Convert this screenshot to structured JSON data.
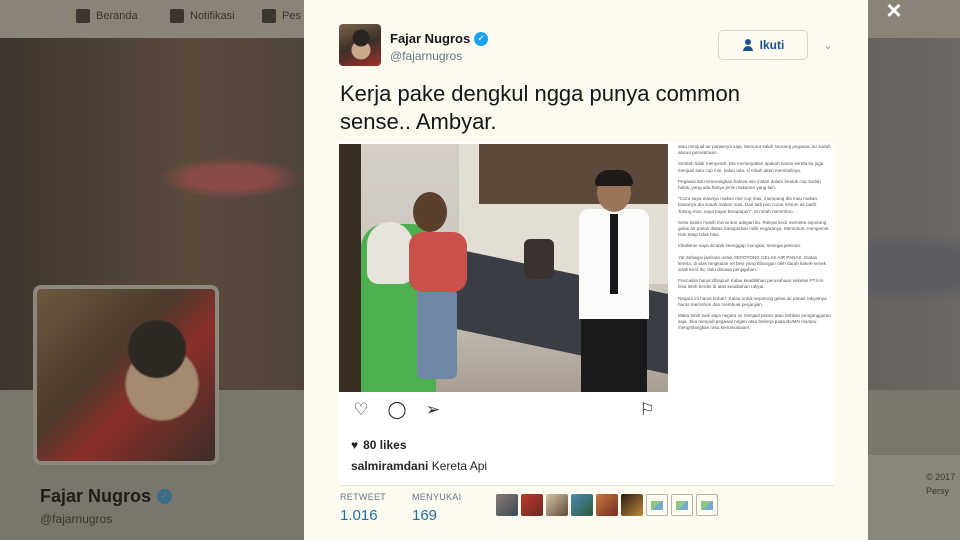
{
  "nav": {
    "home_label": "Beranda",
    "notifications_label": "Notifikasi",
    "messages_label": "Pes"
  },
  "profile": {
    "name": "Fajar Nugros",
    "handle": "@fajarnugros",
    "verified_mark": "✓"
  },
  "footer": {
    "copyright": "© 2017",
    "extra": "Persy"
  },
  "close_label": "×",
  "tweet": {
    "author_name": "Fajar Nugros",
    "author_handle": "@fajarnugros",
    "verified_mark": "✓",
    "follow_label": "Ikuti",
    "menu_caret": "⌄",
    "text": "Kerja pake dengkul ngga punya common sense.. Ambyar.",
    "media": {
      "likes_heart": "♥",
      "likes": "80 likes",
      "caption_user": "salmiramdani",
      "caption_text": "Kereta Api",
      "article_paragraphs": [
        "atau menjual air panasnya saja. Menurut salah seorang pegawai, itu sudah aturan perusahaan.",
        "Simbah tidak menyerah. Dia menanyakan apakah kantin kereta itu juga menjual satu cup mie, kalau ada, si mbah akan membelinya.",
        "Pegawai tsb menerangkan bahwa mie instan dalam bentuk cup sudah habis, yang ada hanya jenis makanan yang lain.",
        "\"Cucu saya maunya makan mie cup mas, mumpung dia mau makan, biasanya dia susah makan mas. Dari tadi pun cuma minum air putih. Tolong mas, saya bayar berapapun\". Si mbah memohon.",
        "Sesa kantin masih menonton adegan itu. Rakyat kecil meminta sepotong gelas air panas diatas transportasi milik negaranya. Memohon, mengemis. Dan tetap tidak bisa.",
        "Idealisme saya dicabik seenggap mungkin, sesegai jaminan.",
        "Ya! Sebagai jaminan untuk SEPOTONG GELAS AIR PANAS. Diatas kereta, di atas rangkaian rel besi yang dibangun oleh darah kakek-nenek anak kecil itu, dulu dimasa penjajahan.",
        "Pancasila harus dihapus! Kalau keadilahan perusahaan sekelas PT.KAI bisa lebih berdiri di atas keadilahan rakyat.",
        "Negara ini harus bubar!. Kalau untuk sepotong gelas air panas rakyatnya harus memohon dan membuat perjanjian.",
        "Maka lebih baik saya negara ini menjadi petani atau bahkan pengangguran saja. Jika menjadi pegawai negeri atau bekerja pada BUMN mampu menghilangkan rasa kemanusiaan!."
      ]
    },
    "stats": {
      "retweet_label": "RETWEET",
      "retweet_count": "1.016",
      "likes_label": "MENYUKAI",
      "likes_count": "169"
    }
  },
  "icons": {
    "like": "heart-outline",
    "comment": "speech-bubble",
    "share": "paper-plane",
    "save": "bookmark",
    "follow": "person-plus",
    "close": "x-mark"
  }
}
